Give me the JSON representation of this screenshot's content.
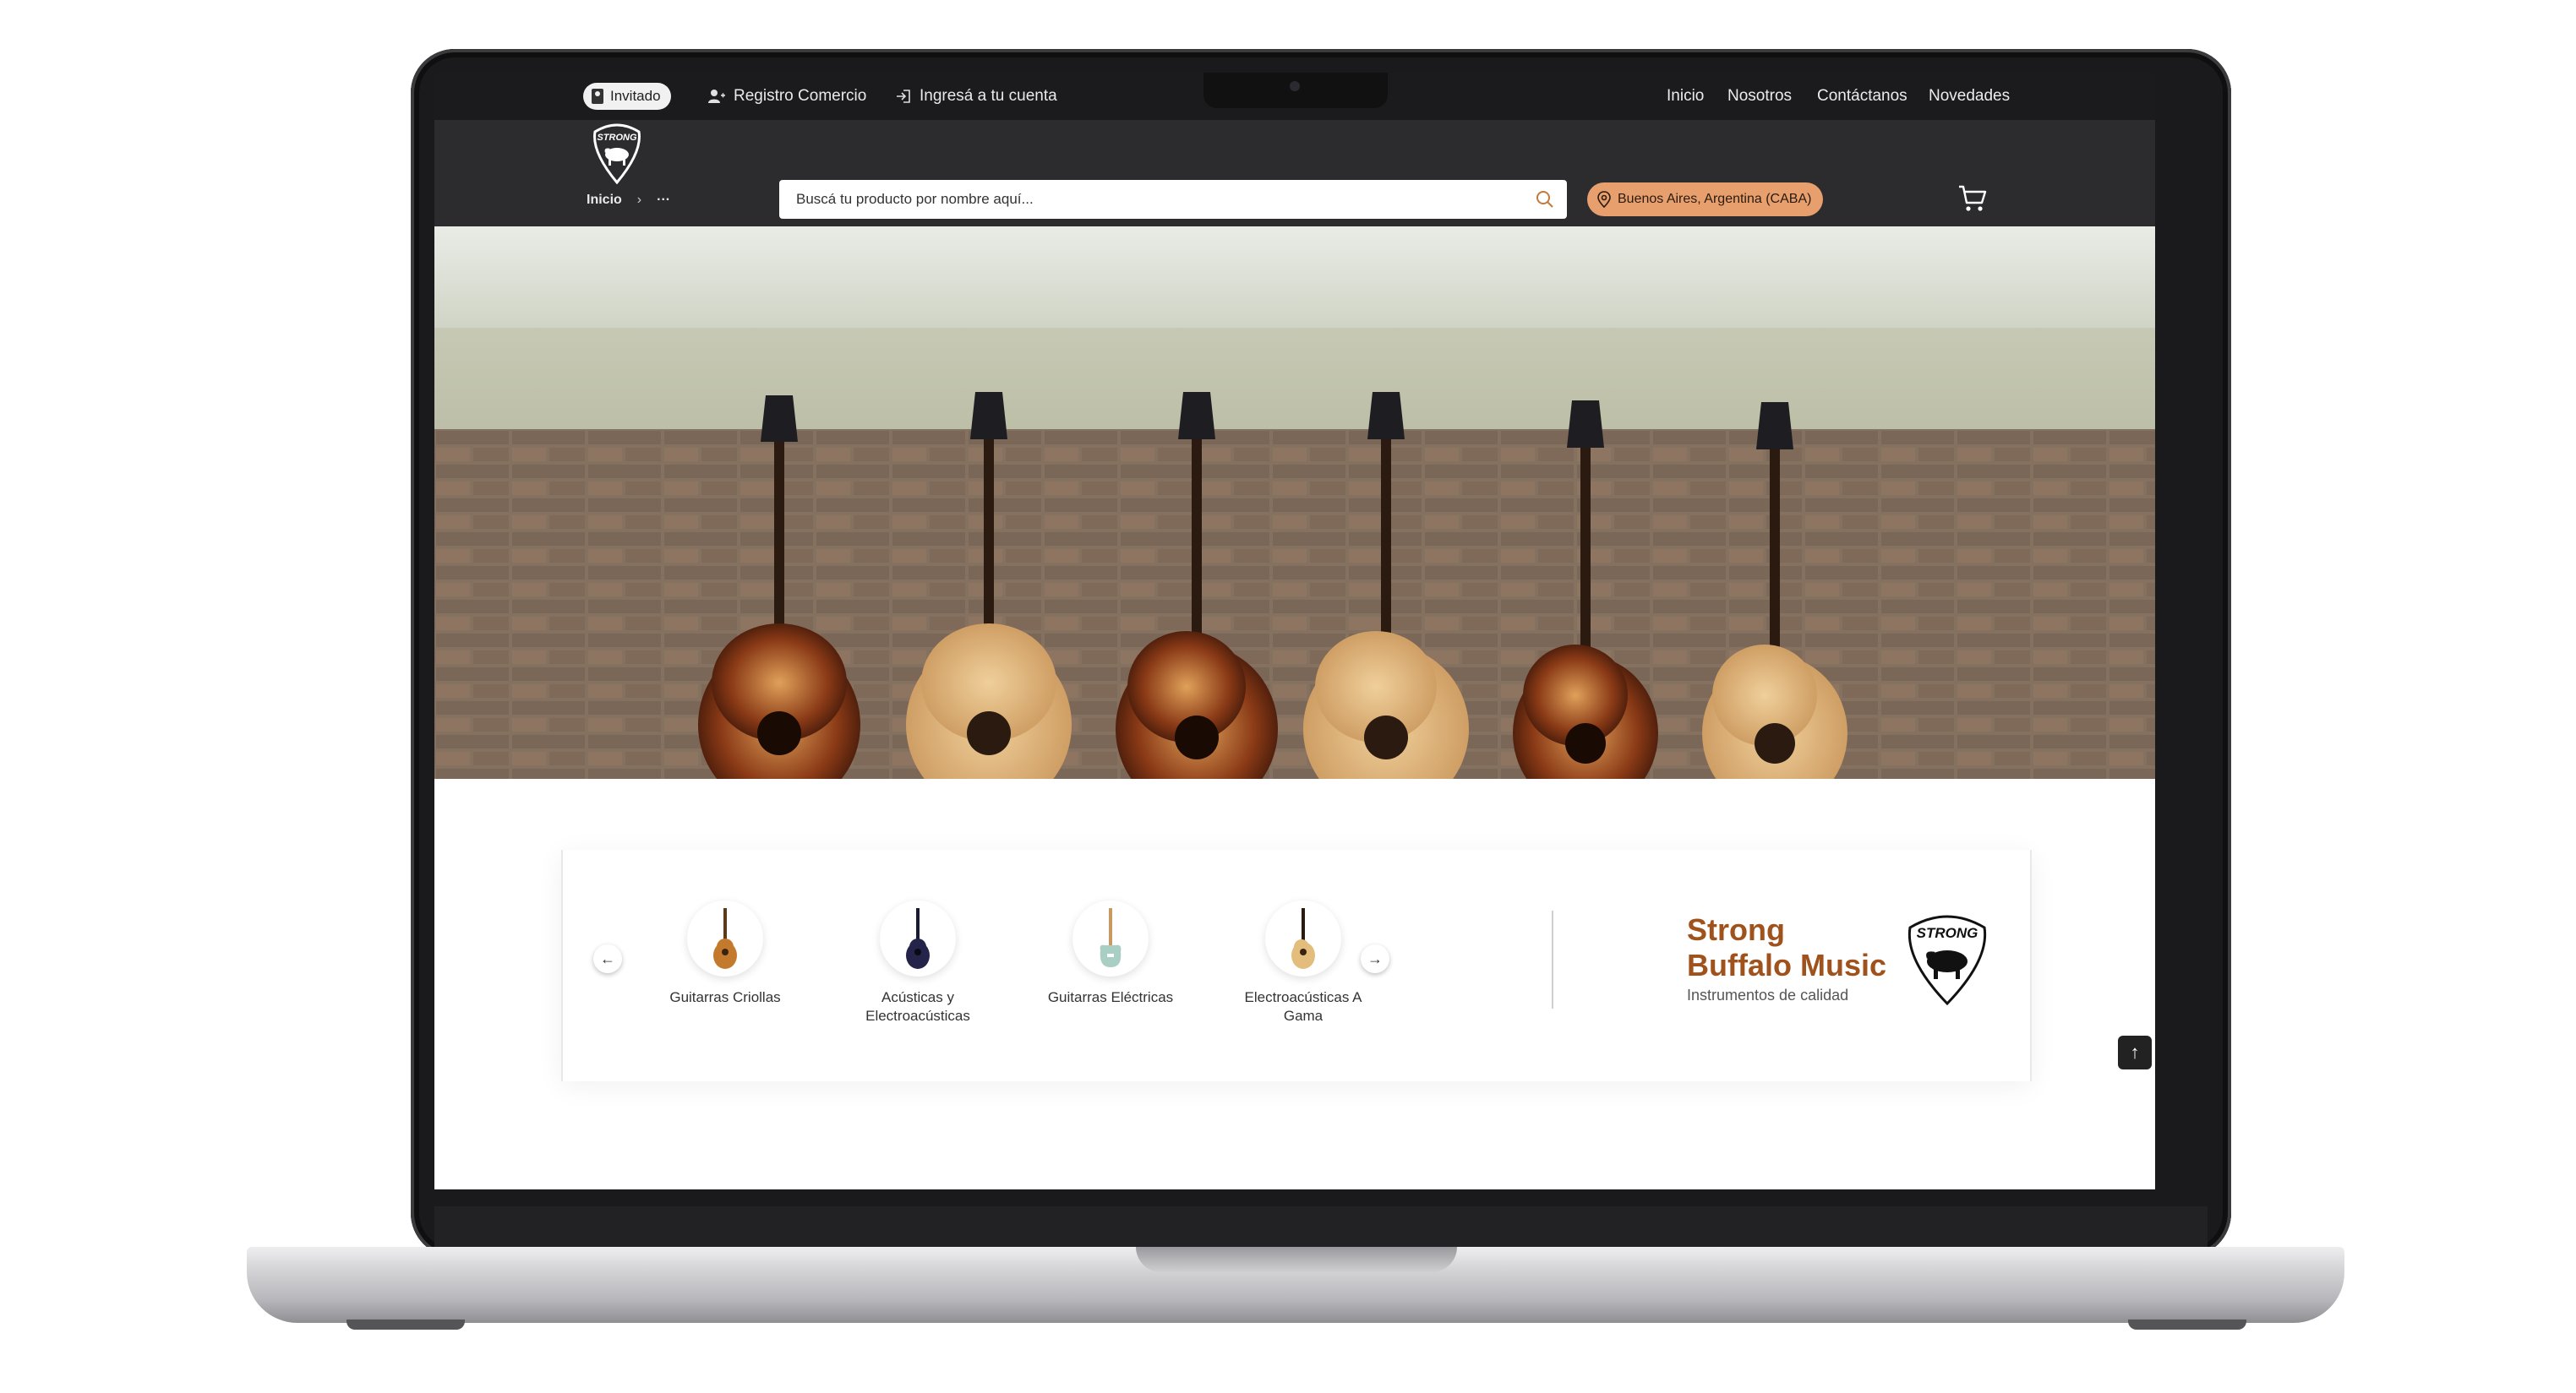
{
  "header": {
    "guest_badge": "Invitado",
    "register_link": "Registro Comercio",
    "login_link": "Ingresá a tu cuenta",
    "nav": [
      "Inicio",
      "Nosotros",
      "Contáctanos",
      "Novedades"
    ],
    "search_placeholder": "Buscá tu producto por nombre aquí...",
    "location": "Buenos Aires, Argentina (CABA)",
    "breadcrumb": {
      "home": "Inicio",
      "separator": "›",
      "more": "···"
    }
  },
  "logo": {
    "text": "STRONG"
  },
  "categories": [
    {
      "label": "Guitarras Criollas",
      "icon": "classical-guitar-icon"
    },
    {
      "label": "Acústicas y Electroacústicas",
      "icon": "acoustic-guitar-icon"
    },
    {
      "label": "Guitarras Eléctricas",
      "icon": "electric-guitar-icon"
    },
    {
      "label": "Electroacústicas A Gama",
      "icon": "electroacoustic-guitar-icon"
    }
  ],
  "brand": {
    "title_line1": "Strong",
    "title_line2": "Buffalo Music",
    "subtitle": "Instrumentos de calidad",
    "logo_text": "STRONG"
  },
  "colors": {
    "accent": "#a0521d",
    "location_pill": "#e7a06d",
    "header_dark": "#2c2c2f",
    "topbar": "#1b1b1d"
  }
}
